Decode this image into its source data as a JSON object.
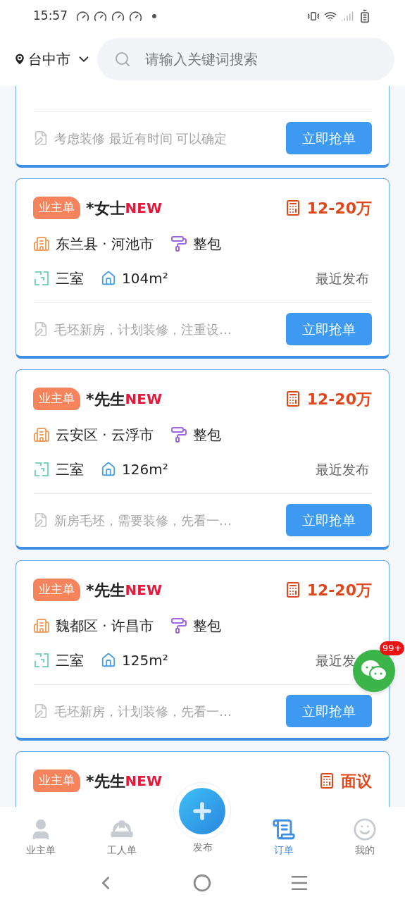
{
  "status_bar": {
    "time": "15:57"
  },
  "header": {
    "city": "台中市",
    "search": {
      "placeholder": "请输入关键词搜索"
    }
  },
  "orders": [
    {
      "note": "考虑装修 最近有时间 可以确定",
      "button": "立即抢单"
    },
    {
      "tag": "业主单",
      "name": "*女士",
      "badge": "NEW",
      "price": "12-20万",
      "location": "东兰县 · 河池市",
      "type": "整包",
      "rooms": "三室",
      "area": "104m²",
      "time": "最近发布",
      "note": "毛坯新房，计划装修，注重设…",
      "button": "立即抢单"
    },
    {
      "tag": "业主单",
      "name": "*先生",
      "badge": "NEW",
      "price": "12-20万",
      "location": "云安区 · 云浮市",
      "type": "整包",
      "rooms": "三室",
      "area": "126m²",
      "time": "最近发布",
      "note": "新房毛坯，需要装修，先看一…",
      "button": "立即抢单"
    },
    {
      "tag": "业主单",
      "name": "*先生",
      "badge": "NEW",
      "price": "12-20万",
      "location": "魏都区 · 许昌市",
      "type": "整包",
      "rooms": "三室",
      "area": "125m²",
      "time": "最近发",
      "note": "毛坯新房，计划装修，先看一…",
      "button": "立即抢单"
    },
    {
      "tag": "业主单",
      "name": "*先生",
      "badge": "NEW",
      "price": "面议"
    }
  ],
  "chat": {
    "badge": "99+"
  },
  "bottom_nav": [
    {
      "label": "业主单",
      "kind": "owner",
      "selected": false
    },
    {
      "label": "工人单",
      "kind": "worker",
      "selected": false
    },
    {
      "label": "发布",
      "kind": "publish",
      "selected": false
    },
    {
      "label": "订单",
      "kind": "orders",
      "selected": true
    },
    {
      "label": "我的",
      "kind": "me",
      "selected": false
    }
  ]
}
